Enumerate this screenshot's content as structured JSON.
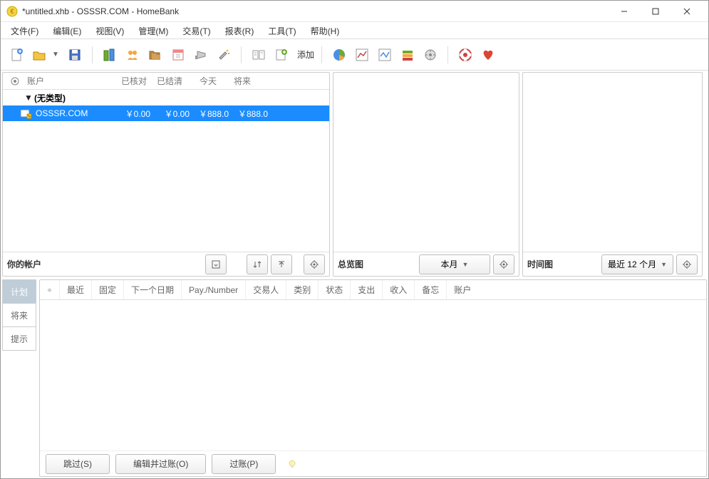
{
  "window": {
    "title": "*untitled.xhb - OSSSR.COM - HomeBank"
  },
  "menubar": {
    "file": "文件(F)",
    "edit": "编辑(E)",
    "view": "视图(V)",
    "manage": "管理(M)",
    "transaction": "交易(T)",
    "report": "报表(R)",
    "tools": "工具(T)",
    "help": "帮助(H)"
  },
  "toolbar": {
    "add_label": "添加"
  },
  "accounts": {
    "header": {
      "account": "账户",
      "reconciled": "已核对",
      "cleared": "已结清",
      "today": "今天",
      "future": "将来"
    },
    "group_label": "(无类型)",
    "row": {
      "name": "OSSSR.COM",
      "reconciled": "￥0.00",
      "cleared": "￥0.00",
      "today": "￥888.0",
      "future": "￥888.0"
    },
    "footer_label": "你的帐户"
  },
  "overview": {
    "footer_label": "总览图",
    "range": "本月"
  },
  "timeline": {
    "footer_label": "时间图",
    "range": "最近 12 个月"
  },
  "bottom": {
    "tabs": {
      "plan": "计划",
      "future": "将来",
      "hint": "提示"
    },
    "plan_columns": {
      "recent": "最近",
      "fixed": "固定",
      "next_date": "下一个日期",
      "pay_number": "Pay./Number",
      "trader": "交易人",
      "category": "类别",
      "status": "状态",
      "expense": "支出",
      "income": "收入",
      "memo": "备忘",
      "account": "账户"
    },
    "footer_buttons": {
      "skip": "跳过(S)",
      "edit_post": "编辑并过账(O)",
      "post": "过账(P)"
    }
  }
}
